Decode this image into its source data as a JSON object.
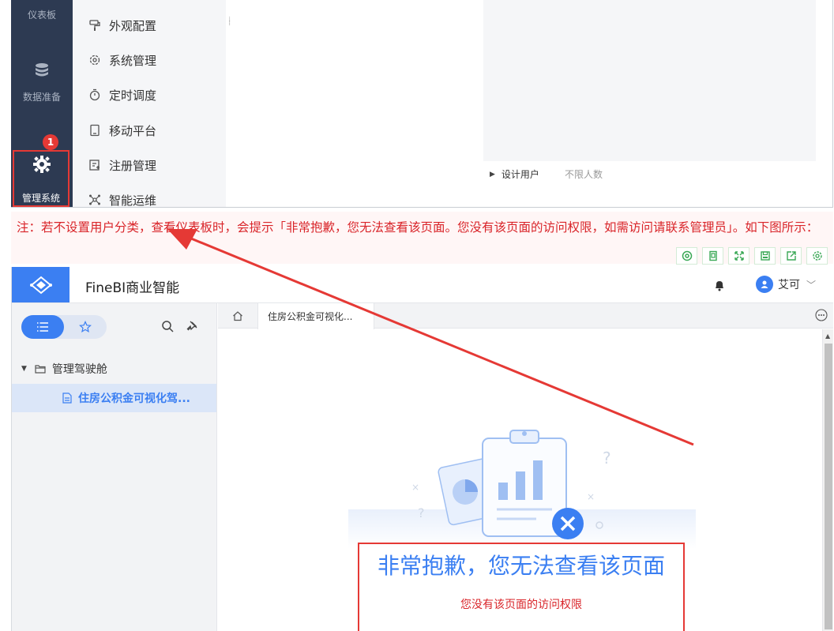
{
  "top_shot": {
    "dark_nav": {
      "dashboard": "仪表板",
      "data_prep": "数据准备",
      "manage_system": "管理系统",
      "badge": "1"
    },
    "sub_menu": [
      "外观配置",
      "系统管理",
      "定时调度",
      "移动平台",
      "注册管理",
      "智能运维"
    ],
    "design_user": {
      "label": "设计用户",
      "value": "不限人数"
    }
  },
  "note": {
    "text": "注：若不设置用户分类，查看仪表板时，会提示「非常抱歉，您无法查看该页面。您没有该页面的访问权限，如需访问请联系管理员」。如下图所示："
  },
  "note_toolbar": [
    "quote-icon",
    "copy-icon",
    "expand-icon",
    "save-icon",
    "share-icon",
    "settings-icon"
  ],
  "app": {
    "title": "FineBI商业智能",
    "user": "艾可",
    "folder": "管理驾驶舱",
    "report": "住房公积金可视化驾...",
    "tab": "住房公积金可视化...",
    "error_title": "非常抱歉，您无法查看该页面",
    "error_sub": "您没有该页面的访问权限"
  },
  "colors": {
    "accent": "#3b7ff2",
    "dark_nav": "#2d3a52",
    "alert_red": "#e53935",
    "note_red": "#d9252a"
  }
}
